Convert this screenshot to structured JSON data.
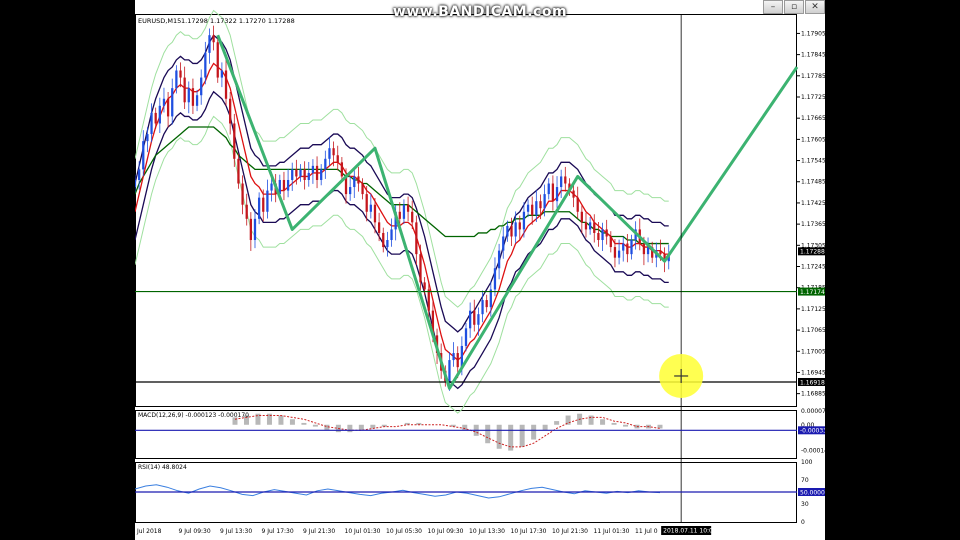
{
  "watermark": "www.BANDICAM.com",
  "window_buttons": [
    "–",
    "▫",
    "✕"
  ],
  "chart_data": [
    {
      "type": "line",
      "name": "price-panel",
      "title": "EURUSD,M15",
      "subtitle": "1.17298 1.17322 1.17270 1.17288",
      "ylim": [
        1.1685,
        1.1796
      ],
      "y_ticks": [
        "1.17905",
        "1.17845",
        "1.17785",
        "1.17725",
        "1.17665",
        "1.17605",
        "1.17545",
        "1.17485",
        "1.17425",
        "1.17365",
        "1.17305",
        "1.17245",
        "1.17185",
        "1.17125",
        "1.17065",
        "1.17005",
        "1.16945",
        "1.16885"
      ],
      "price_labels": [
        {
          "value": 1.17288,
          "text": "1.17288",
          "color": "#000000"
        },
        {
          "value": 1.17174,
          "text": "1.17174",
          "color": "#006400"
        },
        {
          "value": 1.16918,
          "text": "1.16918",
          "color": "#000000"
        }
      ],
      "horizontal_lines": [
        {
          "value": 1.17174,
          "color": "#006400"
        },
        {
          "value": 1.16918,
          "color": "#000000"
        }
      ],
      "x_range": [
        0,
        160
      ],
      "close": [
        1.1749,
        1.1752,
        1.176,
        1.1762,
        1.1768,
        1.1765,
        1.177,
        1.1772,
        1.1767,
        1.1775,
        1.178,
        1.1778,
        1.1771,
        1.1775,
        1.177,
        1.1773,
        1.1778,
        1.1785,
        1.179,
        1.1788,
        1.1778,
        1.178,
        1.1772,
        1.1765,
        1.1755,
        1.1748,
        1.1742,
        1.1738,
        1.1732,
        1.1738,
        1.1744,
        1.174,
        1.1746,
        1.1748,
        1.1745,
        1.1749,
        1.1746,
        1.1749,
        1.1752,
        1.175,
        1.1752,
        1.1749,
        1.1751,
        1.1753,
        1.1749,
        1.1752,
        1.1755,
        1.1758,
        1.1756,
        1.1754,
        1.175,
        1.1745,
        1.1747,
        1.175,
        1.1748,
        1.1745,
        1.174,
        1.1742,
        1.1737,
        1.1734,
        1.173,
        1.1732,
        1.1735,
        1.174,
        1.1738,
        1.1742,
        1.174,
        1.1737,
        1.1728,
        1.172,
        1.1718,
        1.1712,
        1.1705,
        1.17,
        1.1695,
        1.1692,
        1.1698,
        1.17,
        1.1696,
        1.1702,
        1.1707,
        1.1712,
        1.1708,
        1.1711,
        1.1715,
        1.1713,
        1.1718,
        1.1724,
        1.1729,
        1.1733,
        1.1736,
        1.1733,
        1.1737,
        1.1735,
        1.174,
        1.1742,
        1.1739,
        1.1743,
        1.1741,
        1.1745,
        1.1748,
        1.1743,
        1.1747,
        1.175,
        1.1748,
        1.1746,
        1.1744,
        1.174,
        1.1737,
        1.1735,
        1.1737,
        1.1734,
        1.1732,
        1.1735,
        1.1733,
        1.173,
        1.1727,
        1.1729,
        1.1731,
        1.1728,
        1.1732,
        1.1735,
        1.1731,
        1.1728,
        1.173,
        1.1727,
        1.1729,
        1.1728,
        1.1726,
        1.1728
      ],
      "ma_red": [
        1.174,
        1.1745,
        1.175,
        1.1755,
        1.176,
        1.1764,
        1.1767,
        1.177,
        1.1772,
        1.1773,
        1.1775,
        1.1776,
        1.1775,
        1.1775,
        1.1774,
        1.1774,
        1.1775,
        1.1777,
        1.178,
        1.1782,
        1.1781,
        1.178,
        1.1778,
        1.1775,
        1.177,
        1.1765,
        1.176,
        1.1755,
        1.175,
        1.1748,
        1.1747,
        1.1745,
        1.1745,
        1.1745,
        1.1745,
        1.1746,
        1.1746,
        1.1747,
        1.1748,
        1.1749,
        1.175,
        1.175,
        1.175,
        1.1751,
        1.1751,
        1.1751,
        1.1752,
        1.1753,
        1.1754,
        1.1754,
        1.1753,
        1.1751,
        1.175,
        1.175,
        1.1749,
        1.1748,
        1.1746,
        1.1745,
        1.1743,
        1.1741,
        1.1739,
        1.1737,
        1.1736,
        1.1736,
        1.1736,
        1.1737,
        1.1737,
        1.1736,
        1.1733,
        1.1729,
        1.1725,
        1.172,
        1.1715,
        1.171,
        1.1705,
        1.1701,
        1.17,
        1.1699,
        1.1698,
        1.1699,
        1.1701,
        1.1703,
        1.1704,
        1.1706,
        1.1708,
        1.171,
        1.1712,
        1.1715,
        1.1718,
        1.1722,
        1.1726,
        1.1728,
        1.1731,
        1.1732,
        1.1734,
        1.1736,
        1.1737,
        1.1738,
        1.1739,
        1.1741,
        1.1743,
        1.1743,
        1.1744,
        1.1746,
        1.1746,
        1.1746,
        1.1745,
        1.1744,
        1.1742,
        1.174,
        1.1739,
        1.1737,
        1.1736,
        1.1735,
        1.1734,
        1.1733,
        1.1731,
        1.1731,
        1.1731,
        1.173,
        1.173,
        1.1731,
        1.1731,
        1.173,
        1.173,
        1.1729,
        1.1729,
        1.1729,
        1.1728,
        1.1728
      ],
      "ma_green": [
        1.1745,
        1.1748,
        1.175,
        1.1752,
        1.1754,
        1.1756,
        1.1757,
        1.1758,
        1.1759,
        1.176,
        1.1761,
        1.1762,
        1.1763,
        1.1764,
        1.1764,
        1.1764,
        1.1764,
        1.1764,
        1.1764,
        1.1764,
        1.1763,
        1.1762,
        1.1761,
        1.1759,
        1.1758,
        1.1756,
        1.1755,
        1.1754,
        1.1753,
        1.1752,
        1.1752,
        1.1752,
        1.1752,
        1.1752,
        1.1752,
        1.1752,
        1.1752,
        1.1752,
        1.1752,
        1.1752,
        1.1752,
        1.1752,
        1.1752,
        1.1752,
        1.1752,
        1.1752,
        1.1752,
        1.1752,
        1.1752,
        1.1752,
        1.1751,
        1.175,
        1.175,
        1.1749,
        1.1749,
        1.1748,
        1.1748,
        1.1747,
        1.1746,
        1.1745,
        1.1744,
        1.1743,
        1.1742,
        1.1742,
        1.1742,
        1.1742,
        1.1742,
        1.1741,
        1.174,
        1.1739,
        1.1738,
        1.1737,
        1.1736,
        1.1735,
        1.1734,
        1.1733,
        1.1733,
        1.1733,
        1.1733,
        1.1733,
        1.1733,
        1.1733,
        1.1733,
        1.1734,
        1.1734,
        1.1734,
        1.1735,
        1.1735,
        1.1736,
        1.1736,
        1.1737,
        1.1737,
        1.1738,
        1.1738,
        1.1738,
        1.1739,
        1.1739,
        1.1739,
        1.1739,
        1.174,
        1.174,
        1.174,
        1.174,
        1.174,
        1.174,
        1.174,
        1.1739,
        1.1738,
        1.1737,
        1.1737,
        1.1736,
        1.1735,
        1.1735,
        1.1734,
        1.1734,
        1.1733,
        1.1733,
        1.1733,
        1.1733,
        1.1732,
        1.1732,
        1.1732,
        1.1731,
        1.1731,
        1.1731,
        1.1731,
        1.1731,
        1.1731,
        1.1731,
        1.1731
      ],
      "band_offset_inner": 0.0008,
      "band_offset_outer": 0.0015,
      "zigzag": [
        [
          20,
          1.179
        ],
        [
          38,
          1.1735
        ],
        [
          58,
          1.1758
        ],
        [
          76,
          1.169
        ],
        [
          107,
          1.175
        ],
        [
          128,
          1.1726
        ],
        [
          160,
          1.1781
        ]
      ],
      "zigzag_color": "#3cb371",
      "crosshair_x": 132,
      "cursor_price": 1.16935,
      "cursor_color": "#ffff33"
    },
    {
      "type": "line",
      "name": "macd-panel",
      "title": "MACD(12,26,9) -0.000123 -0.000170",
      "ylim": [
        -0.00018,
        8e-05
      ],
      "y_ticks": [
        "0.000075",
        "0.00",
        "-0.00014"
      ],
      "level_label": "-0.00033",
      "level_value": -3e-05,
      "macd": [
        4e-05,
        5e-05,
        6e-05,
        6e-05,
        5e-05,
        3e-05,
        1e-05,
        -1e-05,
        -3e-05,
        -4e-05,
        -4e-05,
        -3e-05,
        -2e-05,
        -1e-05,
        0.0,
        1e-05,
        1e-05,
        0.0,
        0.0,
        -1e-05,
        -3e-05,
        -6e-05,
        -0.0001,
        -0.00013,
        -0.00014,
        -0.00012,
        -8e-05,
        -3e-05,
        2e-05,
        5e-05,
        6e-05,
        5e-05,
        3e-05,
        1e-05,
        -1e-05,
        -2e-05,
        -2e-05,
        -2e-05
      ],
      "signal": [
        3e-05,
        4e-05,
        5e-05,
        5e-05,
        5e-05,
        4e-05,
        3e-05,
        1e-05,
        -1e-05,
        -2e-05,
        -3e-05,
        -3e-05,
        -2e-05,
        -1e-05,
        -1e-05,
        0.0,
        0.0,
        0.0,
        0.0,
        -1e-05,
        -2e-05,
        -4e-05,
        -7e-05,
        -0.0001,
        -0.00012,
        -0.00012,
        -0.0001,
        -6e-05,
        -2e-05,
        1e-05,
        3e-05,
        4e-05,
        4e-05,
        2e-05,
        1e-05,
        -1e-05,
        -1e-05,
        -2e-05
      ]
    },
    {
      "type": "line",
      "name": "rsi-panel",
      "title": "RSI(14) 48.8024",
      "ylim": [
        0,
        100
      ],
      "y_ticks": [
        "100",
        "70",
        "50.0000",
        "30",
        "0"
      ],
      "level_value": 50,
      "values": [
        55,
        60,
        62,
        58,
        52,
        48,
        55,
        60,
        57,
        52,
        46,
        44,
        50,
        54,
        51,
        48,
        45,
        52,
        55,
        52,
        49,
        46,
        44,
        48,
        50,
        53,
        49,
        46,
        43,
        45,
        50,
        48,
        44,
        40,
        42,
        47,
        52,
        56,
        58,
        54,
        50,
        47,
        52,
        50,
        48,
        51,
        49,
        52,
        50,
        49
      ]
    }
  ],
  "x_axis": {
    "labels": [
      "Jul 2018",
      "9 Jul 09:30",
      "9 Jul 13:30",
      "9 Jul 17:30",
      "9 Jul 21:30",
      "10 Jul 01:30",
      "10 Jul 05:30",
      "10 Jul 09:30",
      "10 Jul 13:30",
      "10 Jul 17:30",
      "10 Jul 21:30",
      "11 Jul 01:30",
      "11 Jul 0"
    ],
    "crosshair_label": "2018.07.11 10:00"
  }
}
